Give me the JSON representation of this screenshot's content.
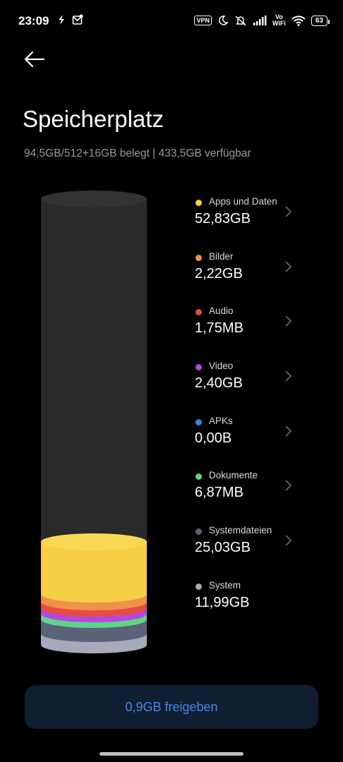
{
  "status_bar": {
    "time": "23:09",
    "vpn": "VPN",
    "vowifi_top": "Vo",
    "vowifi_bottom": "WiFi",
    "battery": "63"
  },
  "header": {
    "back_icon": "arrow-left-icon",
    "title": "Speicherplatz"
  },
  "summary": "94,5GB/512+16GB belegt | 433,5GB verfügbar",
  "categories": [
    {
      "label": "Apps und Daten",
      "value": "52,83GB",
      "color": "#f5cf45",
      "chevron": true
    },
    {
      "label": "Bilder",
      "value": "2,22GB",
      "color": "#f0914a",
      "chevron": true
    },
    {
      "label": "Audio",
      "value": "1,75MB",
      "color": "#e74c43",
      "chevron": true
    },
    {
      "label": "Video",
      "value": "2,40GB",
      "color": "#b447e0",
      "chevron": true
    },
    {
      "label": "APKs",
      "value": "0,00B",
      "color": "#3f7fe8",
      "chevron": true
    },
    {
      "label": "Dokumente",
      "value": "6,87MB",
      "color": "#5fd38a",
      "chevron": true
    },
    {
      "label": "Systemdateien",
      "value": "25,03GB",
      "color": "#5a6378",
      "chevron": true
    },
    {
      "label": "System",
      "value": "11,99GB",
      "color": "#a7aabb",
      "chevron": false
    }
  ],
  "free_button": "0,9GB freigeben",
  "colors": {
    "background": "#000000",
    "accent": "#4a86e8",
    "button_bg": "#0f1e31",
    "cylinder": "#2b2b2b"
  }
}
